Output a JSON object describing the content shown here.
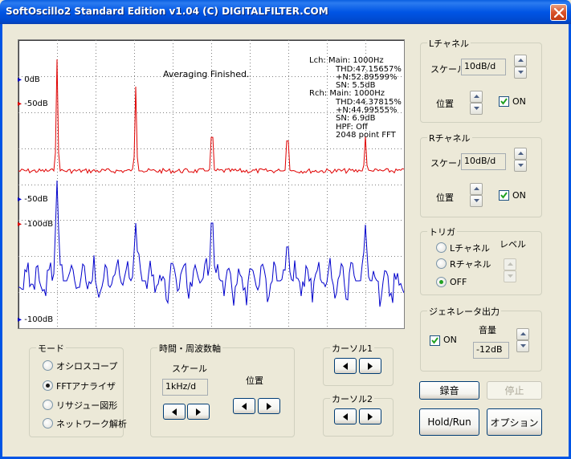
{
  "window": {
    "title": "SoftOscillo2 Standard Edition v1.04 (C) DIGITALFILTER.COM"
  },
  "scope": {
    "status": "Averaging Finished.",
    "info_lines": [
      "Lch:   Main: 1000Hz",
      "THD:47.15657%",
      "+N:52.89599%",
      "SN:  5.5dB",
      "Rch:   Main: 1000Hz",
      "THD:44.37815%",
      "+N:44.99555%",
      "SN:  6.9dB",
      "HPF: Off",
      "2048 point FFT"
    ],
    "markers": {
      "l_zero": "0dB",
      "l_minus50": "-50dB",
      "r_minus50": "-50dB",
      "r_minus100": "-100dB",
      "bottom_minus100": "-100dB"
    },
    "colors": {
      "lch": "#E00000",
      "rch": "#0000CC",
      "grid": "#808080"
    }
  },
  "lch": {
    "title": "Lチャネル",
    "scale_label": "スケール",
    "scale_value": "10dB/d",
    "position_label": "位置",
    "on_label": "ON",
    "on_checked": true
  },
  "rch": {
    "title": "Rチャネル",
    "scale_label": "スケール",
    "scale_value": "10dB/d",
    "position_label": "位置",
    "on_label": "ON",
    "on_checked": true
  },
  "trigger": {
    "title": "トリガ",
    "options": [
      "Lチャネル",
      "Rチャネル",
      "OFF"
    ],
    "selected": "OFF",
    "level_label": "レベル"
  },
  "generator": {
    "title": "ジェネレータ出力",
    "on_label": "ON",
    "on_checked": true,
    "volume_label": "音量",
    "volume_value": "-12dB"
  },
  "mode": {
    "title": "モード",
    "options": [
      "オシロスコープ",
      "FFTアナライザ",
      "リサジュー図形",
      "ネットワーク解析"
    ],
    "selected": "FFTアナライザ"
  },
  "timebase": {
    "title": "時間・周波数軸",
    "scale_label": "スケール",
    "scale_value": "1kHz/d",
    "position_label": "位置"
  },
  "cursor1": {
    "title": "カーソル1"
  },
  "cursor2": {
    "title": "カーソル2"
  },
  "buttons": {
    "record": "録音",
    "stop": "停止",
    "hold_run": "Hold/Run",
    "options": "オプション"
  }
}
